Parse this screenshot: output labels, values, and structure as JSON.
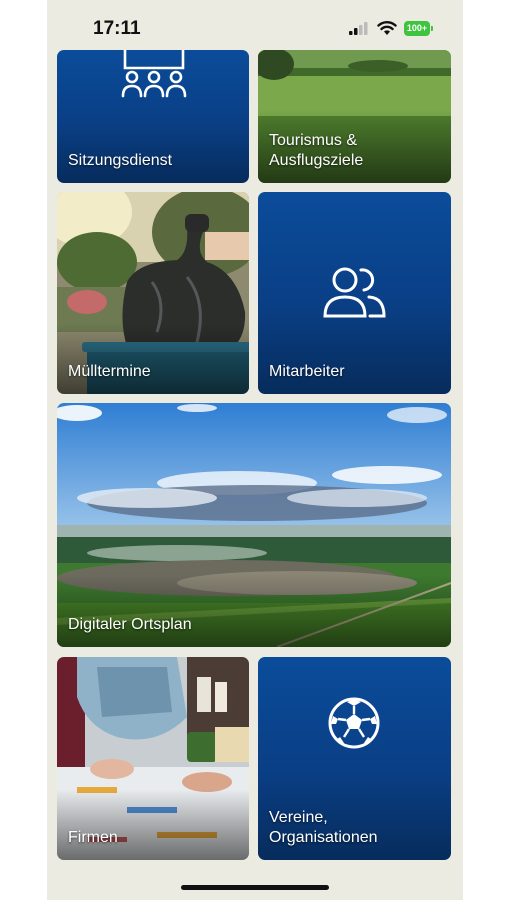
{
  "status_bar": {
    "time": "17:11",
    "battery": "100+",
    "signal_icon": "cellular-signal-icon",
    "wifi_icon": "wifi-icon",
    "battery_color": "#3ec43e"
  },
  "tiles": [
    {
      "label": "Sitzungsdienst",
      "icon": "meeting-people-icon"
    },
    {
      "label": "Tourismus & Ausflugsziele",
      "icon": "landscape-photo"
    },
    {
      "label": "Mülltermine",
      "icon": "garbage-bag-photo"
    },
    {
      "label": "Mitarbeiter",
      "icon": "people-icon"
    },
    {
      "label": "Digitaler Ortsplan",
      "icon": "aerial-town-photo"
    },
    {
      "label": "Firmen",
      "icon": "team-work-photo"
    },
    {
      "label": "Vereine, Organisationen",
      "icon": "soccer-ball-icon"
    }
  ],
  "colors": {
    "background": "#ecebe2",
    "tile_blue": "#0b4c9a",
    "tile_blue_dark": "#072c5c"
  }
}
